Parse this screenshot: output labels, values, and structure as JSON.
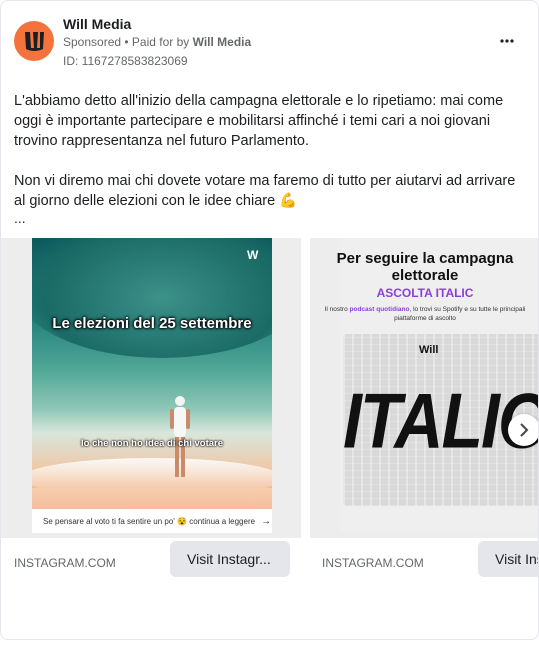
{
  "post": {
    "page_name": "Will Media",
    "sponsored": "Sponsored",
    "paid_prefix": " • Paid for by ",
    "paid_by": "Will Media",
    "ad_id": "ID: 1167278583823069",
    "body_p1": "L'abbiamo detto all'inizio della campagna elettorale e lo ripetiamo: mai come oggi è importante partecipare e mobilitarsi affinché i temi cari a noi giovani trovino rappresentanza nel futuro Parlamento.",
    "body_p2": "Non vi diremo mai chi dovete votare ma faremo di tutto per aiutarvi ad arrivare al giorno delle elezioni con le idee chiare 💪",
    "ellipsis": "..."
  },
  "carousel": {
    "cards": [
      {
        "image_title": "Le elezioni del 25 settembre",
        "image_caption": "Io che non ho idea di chi votare",
        "image_bottom": "Se pensare al voto ti fa sentire un po' 😵 continua a leggere",
        "logo": "W",
        "domain": "INSTAGRAM.COM",
        "button": "Visit Instagr..."
      },
      {
        "image_title": "Per seguire la campagna elettorale",
        "image_subtitle": "ASCOLTA ITALIC",
        "image_small_prefix": "Il nostro ",
        "image_small_highlight": "podcast quotidiano",
        "image_small_suffix": ", lo trovi su Spotify e su tutte le principali piattaforme di ascolto",
        "poster_logo": "Will",
        "poster_text": "ITALIC",
        "domain": "INSTAGRAM.COM",
        "button": "Visit Ins"
      }
    ]
  },
  "colors": {
    "avatar_bg": "#f4733c",
    "accent_purple": "#8b3fd9",
    "button_bg": "#e4e6eb"
  },
  "icons": {
    "more": "more-options-icon",
    "next": "chevron-right-icon"
  }
}
